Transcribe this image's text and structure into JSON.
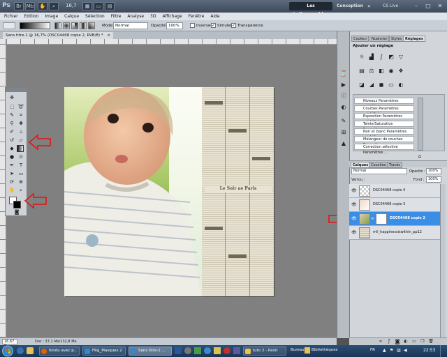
{
  "app": {
    "logo": "Ps",
    "zoom": "16,7",
    "workspace_active": "Les indispensables",
    "workspace_alt": "Conception",
    "workspace_more": "»",
    "cslive": "CS Live",
    "win_min": "–",
    "win_max": "□",
    "win_close": "✕"
  },
  "menu": [
    "Fichier",
    "Edition",
    "Image",
    "Calque",
    "Sélection",
    "Filtre",
    "Analyse",
    "3D",
    "Affichage",
    "Fenêtre",
    "Aide"
  ],
  "options": {
    "mode_label": "Mode:",
    "mode_value": "Normal",
    "opacity_label": "Opacité :",
    "opacity_value": "100%",
    "inverser": "Inverser",
    "simuler": "Simuler",
    "transparence": "Transparence"
  },
  "document": {
    "tab_title": "Sans titre-1 @ 16,7% (DSC04468 copie 2, RVB/8) *",
    "close": "×",
    "newspaper_heading": "Le Soir ae Paris"
  },
  "panel": {
    "tabs": [
      "Couleur",
      "Nuancier",
      "Styles",
      "Réglages"
    ],
    "active_tab": "Réglages",
    "adjust_title": "Ajouter un réglage",
    "presets": [
      "Niveaux Paramètres prédéfini",
      "Courbes Paramètres prédéfinis",
      "Exposition Paramètres prédéfini",
      "Teinte/Saturation Paramètres pr...",
      "Noir et blanc Paramètres prédéfi...",
      "Mélangeur de couches Paramètres...",
      "Correction sélective Paramètres ..."
    ],
    "layers_tabs": [
      "Calques",
      "Couches",
      "Tracés"
    ],
    "blend_mode": "Normal",
    "opacity_label": "Opacité :",
    "opacity_value": "100%",
    "lock_label": "Verrou :",
    "fill_label": "Fond :",
    "fill_value": "100%",
    "layers": [
      {
        "name": "DSC04468 copie 4"
      },
      {
        "name": "DSC04468 copie 3"
      },
      {
        "name": "DSC04468 copie 2"
      },
      {
        "name": "mll_happinessiswithin_pp12"
      }
    ],
    "selected_layer": "DSC04468 copie 2"
  },
  "status": {
    "zoom": "16,67 %",
    "doc": "Doc : 37,1 Mo/132,8 Mo"
  },
  "taskbar": {
    "tasks": [
      "fondu avec p...",
      "FRg_Masques 2",
      "Sans titre-1 ...",
      "tuto 2 - Paint"
    ],
    "active_task": "Sans titre-1 ...",
    "desktop": "Bureau",
    "libraries": "Bibliothèques",
    "lang": "FR",
    "time": "22:53"
  },
  "colors": {
    "arrow": "#e31414",
    "selected_layer": "#3a8ee6"
  }
}
